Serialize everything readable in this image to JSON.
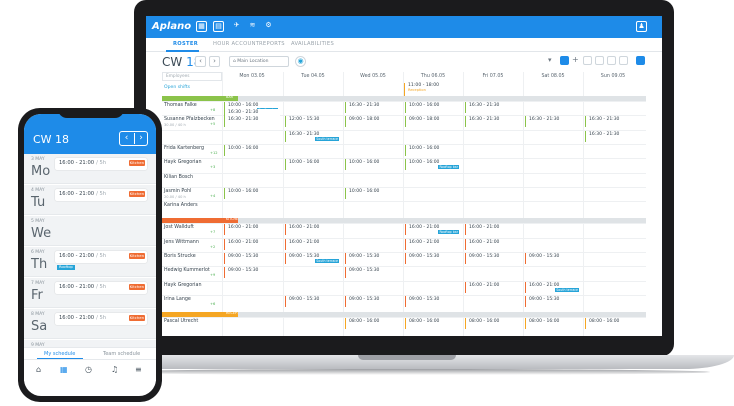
{
  "laptop": {
    "logo": "Aplano",
    "nav": {
      "roster": "ROSTER",
      "hour_account": "HOUR ACCOUNT",
      "reports": "REPORTS",
      "availabilities": "AVAILABILITIES"
    },
    "cw_label": "CW",
    "cw_number": "18",
    "location": "Main Location",
    "search_placeholder": "Employees",
    "days": [
      "Mon 03.05",
      "Tue 04.05",
      "Wed 05.05",
      "Thu 06.05",
      "Fri 07.05",
      "Sat 08.05",
      "Sun 09.05"
    ],
    "open_shifts": {
      "label": "Open shifts",
      "shift": "11:00 - 18:00",
      "tag": "Reception"
    },
    "sections": [
      {
        "name": "BAR",
        "color": "#8bc34a"
      },
      {
        "name": "KITCHEN",
        "color": "#ef6c33"
      },
      {
        "name": "RECEPTION",
        "color": "#f5a623"
      }
    ],
    "employees": [
      {
        "name": "Thomas Falke",
        "sub": "",
        "num": "+8"
      },
      {
        "name": "Susanne Pfalzbecken",
        "sub": "30.00 / 40 h",
        "num": "+5"
      },
      {
        "name": "",
        "sub": "",
        "num": ""
      },
      {
        "name": "Frida Kartenberg",
        "sub": "",
        "num": "+12"
      },
      {
        "name": "Hayk Gregorian",
        "sub": "",
        "num": "+3"
      },
      {
        "name": "Kilian Bosch",
        "sub": "",
        "num": ""
      },
      {
        "name": "Jasmin Pohl",
        "sub": "20.00 / 40 h",
        "num": "+4"
      },
      {
        "name": "Karina Anders",
        "sub": "",
        "num": ""
      },
      {
        "name": "Jost Wallduft",
        "sub": "",
        "num": "+7"
      },
      {
        "name": "Jens Wittmann",
        "sub": "",
        "num": "+2"
      },
      {
        "name": "Boris Strucke",
        "sub": "",
        "num": ""
      },
      {
        "name": "Hedwig Kummerlot",
        "sub": "",
        "num": "+9"
      },
      {
        "name": "Hayk Gregorian",
        "sub": "",
        "num": ""
      },
      {
        "name": "Irina Lange",
        "sub": "",
        "num": "+6"
      },
      {
        "name": "Pascal Utrecht",
        "sub": "",
        "num": ""
      }
    ],
    "shifts": [
      {
        "row": 0,
        "day": 0,
        "time": "10:00 - 16:00",
        "tag": "Rooftop bar"
      },
      {
        "row": 0,
        "day": 2,
        "time": "16:30 - 21:30"
      },
      {
        "row": 0,
        "day": 3,
        "time": "10:00 - 16:00"
      },
      {
        "row": 0,
        "day": 4,
        "time": "16:30 - 21:30"
      },
      {
        "row": 0,
        "day": 0,
        "time": "16:30 - 21:30",
        "sub": 1
      },
      {
        "row": 1,
        "day": 0,
        "time": "16:30 - 21:30"
      },
      {
        "row": 1,
        "day": 1,
        "time": "12:00 - 15:30"
      },
      {
        "row": 1,
        "day": 2,
        "time": "09:00 - 18:00"
      },
      {
        "row": 1,
        "day": 3,
        "time": "09:00 - 18:00"
      },
      {
        "row": 1,
        "day": 4,
        "time": "16:30 - 21:30"
      },
      {
        "row": 1,
        "day": 5,
        "time": "16:30 - 21:30"
      },
      {
        "row": 1,
        "day": 6,
        "time": "16:30 - 21:30"
      },
      {
        "row": 2,
        "day": 1,
        "time": "16:30 - 21:30",
        "tag": "South terrace"
      },
      {
        "row": 2,
        "day": 6,
        "time": "16:30 - 21:30"
      },
      {
        "row": 3,
        "day": 0,
        "time": "10:00 - 16:00"
      },
      {
        "row": 3,
        "day": 3,
        "time": "10:00 - 16:00"
      },
      {
        "row": 4,
        "day": 1,
        "time": "10:00 - 16:00"
      },
      {
        "row": 4,
        "day": 2,
        "time": "10:00 - 16:00"
      },
      {
        "row": 4,
        "day": 3,
        "time": "10:00 - 16:00",
        "tag": "Rooftop bar"
      },
      {
        "row": 6,
        "day": 0,
        "time": "10:00 - 16:00"
      },
      {
        "row": 6,
        "day": 2,
        "time": "10:00 - 16:00"
      },
      {
        "row": 8,
        "day": 0,
        "time": "16:00 - 21:00"
      },
      {
        "row": 8,
        "day": 1,
        "time": "16:00 - 21:00"
      },
      {
        "row": 8,
        "day": 3,
        "time": "16:00 - 21:00",
        "tag": "Rooftop bar"
      },
      {
        "row": 8,
        "day": 4,
        "time": "16:00 - 21:00"
      },
      {
        "row": 9,
        "day": 0,
        "time": "16:00 - 21:00"
      },
      {
        "row": 9,
        "day": 1,
        "time": "16:00 - 21:00"
      },
      {
        "row": 9,
        "day": 3,
        "time": "16:00 - 21:00"
      },
      {
        "row": 9,
        "day": 4,
        "time": "16:00 - 21:00"
      },
      {
        "row": 10,
        "day": 0,
        "time": "09:00 - 15:30"
      },
      {
        "row": 10,
        "day": 1,
        "time": "09:00 - 15:30",
        "tag": "South terrace"
      },
      {
        "row": 10,
        "day": 2,
        "time": "09:00 - 15:30"
      },
      {
        "row": 10,
        "day": 3,
        "time": "09:00 - 15:30"
      },
      {
        "row": 10,
        "day": 4,
        "time": "09:00 - 15:30"
      },
      {
        "row": 10,
        "day": 5,
        "time": "09:00 - 15:30"
      },
      {
        "row": 11,
        "day": 0,
        "time": "09:00 - 15:30"
      },
      {
        "row": 11,
        "day": 2,
        "time": "09:00 - 15:30"
      },
      {
        "row": 12,
        "day": 4,
        "time": "16:00 - 21:00"
      },
      {
        "row": 12,
        "day": 5,
        "time": "16:00 - 21:00",
        "tag": "South terrace"
      },
      {
        "row": 13,
        "day": 1,
        "time": "09:00 - 15:30"
      },
      {
        "row": 13,
        "day": 2,
        "time": "09:00 - 15:30"
      },
      {
        "row": 13,
        "day": 3,
        "time": "09:00 - 15:30"
      },
      {
        "row": 13,
        "day": 5,
        "time": "09:00 - 15:30"
      },
      {
        "row": 14,
        "day": 2,
        "time": "08:00 - 16:00"
      },
      {
        "row": 14,
        "day": 3,
        "time": "08:00 - 16:00"
      },
      {
        "row": 14,
        "day": 4,
        "time": "08:00 - 16:00"
      },
      {
        "row": 14,
        "day": 5,
        "time": "08:00 - 16:00"
      },
      {
        "row": 14,
        "day": 6,
        "time": "08:00 - 16:00"
      }
    ]
  },
  "phone": {
    "cw": "CW 18",
    "days": [
      {
        "date": "3 MAY",
        "name": "Mo",
        "time": "16:00 - 21:00",
        "unit": "/ 5h",
        "tag": "Kitchen"
      },
      {
        "date": "4 MAY",
        "name": "Tu",
        "time": "16:00 - 21:00",
        "unit": "/ 5h",
        "tag": "Kitchen"
      },
      {
        "date": "5 MAY",
        "name": "We"
      },
      {
        "date": "6 MAY",
        "name": "Th",
        "time": "16:00 - 21:00",
        "unit": "/ 5h",
        "tag": "Kitchen",
        "sub": "Rooftop"
      },
      {
        "date": "7 MAY",
        "name": "Fr",
        "time": "16:00 - 21:00",
        "unit": "/ 5h",
        "tag": "Kitchen"
      },
      {
        "date": "8 MAY",
        "name": "Sa",
        "time": "16:00 - 21:00",
        "unit": "/ 5h",
        "tag": "Kitchen"
      },
      {
        "date": "9 MAY",
        "name": ""
      }
    ],
    "tab_my": "My schedule",
    "tab_team": "Team schedule"
  }
}
